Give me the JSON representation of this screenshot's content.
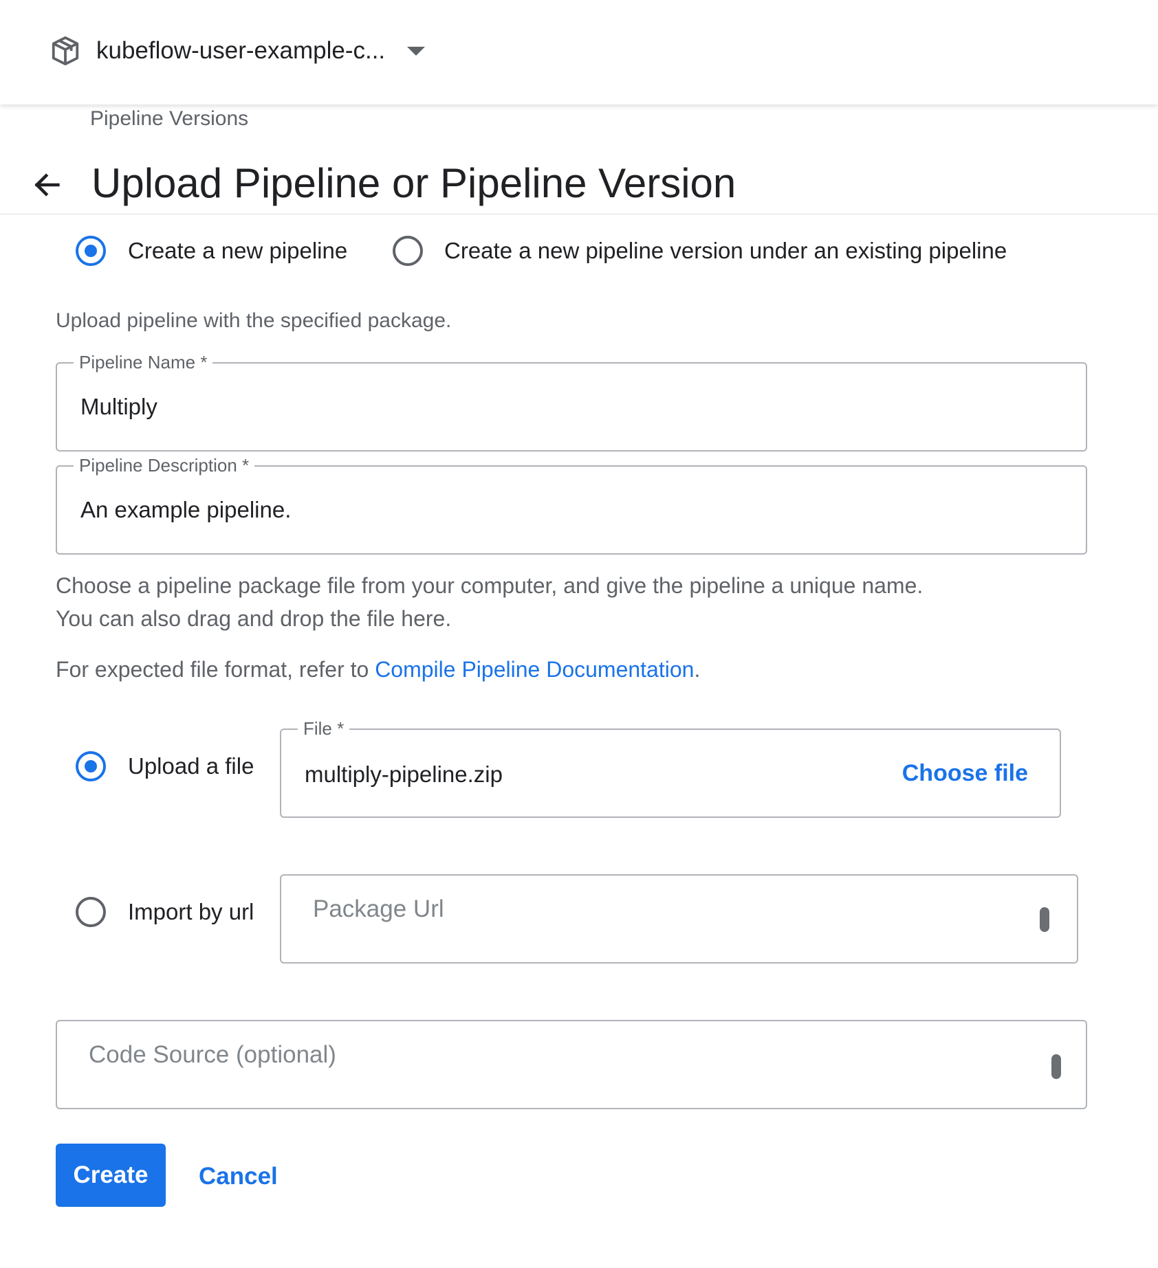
{
  "header": {
    "namespace": "kubeflow-user-example-c..."
  },
  "breadcrumb": "Pipeline Versions",
  "page_title": "Upload Pipeline or Pipeline Version",
  "mode_options": {
    "new_pipeline": {
      "label": "Create a new pipeline",
      "selected": true
    },
    "new_version": {
      "label": "Create a new pipeline version under an existing pipeline",
      "selected": false
    }
  },
  "intro_text": "Upload pipeline with the specified package.",
  "pipeline_name": {
    "label": "Pipeline Name *",
    "value": "Multiply"
  },
  "pipeline_description": {
    "label": "Pipeline Description *",
    "value": "An example pipeline."
  },
  "help": {
    "line1": "Choose a pipeline package file from your computer, and give the pipeline a unique name.",
    "line2": "You can also drag and drop the file here.",
    "format_prefix": "For expected file format, refer to ",
    "format_link": "Compile Pipeline Documentation",
    "format_suffix": "."
  },
  "source_options": {
    "upload_file": {
      "label": "Upload a file",
      "selected": true
    },
    "import_url": {
      "label": "Import by url",
      "selected": false
    }
  },
  "file_field": {
    "label": "File *",
    "value": "multiply-pipeline.zip",
    "choose_label": "Choose file"
  },
  "package_url": {
    "placeholder": "Package Url"
  },
  "code_source": {
    "placeholder": "Code Source (optional)"
  },
  "actions": {
    "create": "Create",
    "cancel": "Cancel"
  },
  "colors": {
    "accent": "#1a73e8",
    "text": "#202124",
    "muted": "#5f6368"
  }
}
